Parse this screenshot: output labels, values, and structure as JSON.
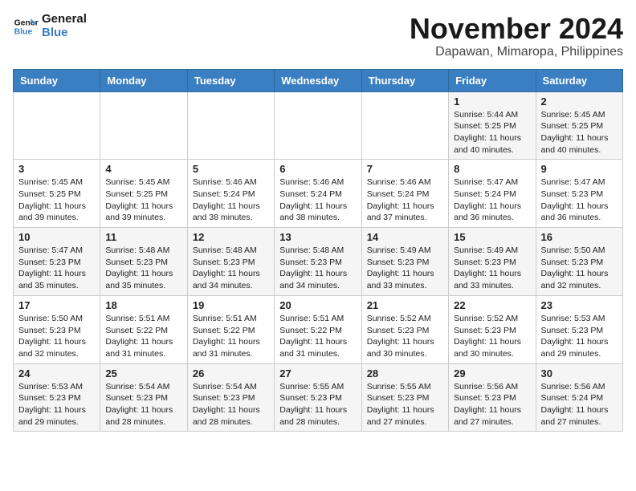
{
  "header": {
    "logo_line1": "General",
    "logo_line2": "Blue",
    "month_title": "November 2024",
    "location": "Dapawan, Mimaropa, Philippines"
  },
  "weekdays": [
    "Sunday",
    "Monday",
    "Tuesday",
    "Wednesday",
    "Thursday",
    "Friday",
    "Saturday"
  ],
  "weeks": [
    [
      {
        "day": "",
        "info": ""
      },
      {
        "day": "",
        "info": ""
      },
      {
        "day": "",
        "info": ""
      },
      {
        "day": "",
        "info": ""
      },
      {
        "day": "",
        "info": ""
      },
      {
        "day": "1",
        "info": "Sunrise: 5:44 AM\nSunset: 5:25 PM\nDaylight: 11 hours\nand 40 minutes."
      },
      {
        "day": "2",
        "info": "Sunrise: 5:45 AM\nSunset: 5:25 PM\nDaylight: 11 hours\nand 40 minutes."
      }
    ],
    [
      {
        "day": "3",
        "info": "Sunrise: 5:45 AM\nSunset: 5:25 PM\nDaylight: 11 hours\nand 39 minutes."
      },
      {
        "day": "4",
        "info": "Sunrise: 5:45 AM\nSunset: 5:25 PM\nDaylight: 11 hours\nand 39 minutes."
      },
      {
        "day": "5",
        "info": "Sunrise: 5:46 AM\nSunset: 5:24 PM\nDaylight: 11 hours\nand 38 minutes."
      },
      {
        "day": "6",
        "info": "Sunrise: 5:46 AM\nSunset: 5:24 PM\nDaylight: 11 hours\nand 38 minutes."
      },
      {
        "day": "7",
        "info": "Sunrise: 5:46 AM\nSunset: 5:24 PM\nDaylight: 11 hours\nand 37 minutes."
      },
      {
        "day": "8",
        "info": "Sunrise: 5:47 AM\nSunset: 5:24 PM\nDaylight: 11 hours\nand 36 minutes."
      },
      {
        "day": "9",
        "info": "Sunrise: 5:47 AM\nSunset: 5:23 PM\nDaylight: 11 hours\nand 36 minutes."
      }
    ],
    [
      {
        "day": "10",
        "info": "Sunrise: 5:47 AM\nSunset: 5:23 PM\nDaylight: 11 hours\nand 35 minutes."
      },
      {
        "day": "11",
        "info": "Sunrise: 5:48 AM\nSunset: 5:23 PM\nDaylight: 11 hours\nand 35 minutes."
      },
      {
        "day": "12",
        "info": "Sunrise: 5:48 AM\nSunset: 5:23 PM\nDaylight: 11 hours\nand 34 minutes."
      },
      {
        "day": "13",
        "info": "Sunrise: 5:48 AM\nSunset: 5:23 PM\nDaylight: 11 hours\nand 34 minutes."
      },
      {
        "day": "14",
        "info": "Sunrise: 5:49 AM\nSunset: 5:23 PM\nDaylight: 11 hours\nand 33 minutes."
      },
      {
        "day": "15",
        "info": "Sunrise: 5:49 AM\nSunset: 5:23 PM\nDaylight: 11 hours\nand 33 minutes."
      },
      {
        "day": "16",
        "info": "Sunrise: 5:50 AM\nSunset: 5:23 PM\nDaylight: 11 hours\nand 32 minutes."
      }
    ],
    [
      {
        "day": "17",
        "info": "Sunrise: 5:50 AM\nSunset: 5:23 PM\nDaylight: 11 hours\nand 32 minutes."
      },
      {
        "day": "18",
        "info": "Sunrise: 5:51 AM\nSunset: 5:22 PM\nDaylight: 11 hours\nand 31 minutes."
      },
      {
        "day": "19",
        "info": "Sunrise: 5:51 AM\nSunset: 5:22 PM\nDaylight: 11 hours\nand 31 minutes."
      },
      {
        "day": "20",
        "info": "Sunrise: 5:51 AM\nSunset: 5:22 PM\nDaylight: 11 hours\nand 31 minutes."
      },
      {
        "day": "21",
        "info": "Sunrise: 5:52 AM\nSunset: 5:23 PM\nDaylight: 11 hours\nand 30 minutes."
      },
      {
        "day": "22",
        "info": "Sunrise: 5:52 AM\nSunset: 5:23 PM\nDaylight: 11 hours\nand 30 minutes."
      },
      {
        "day": "23",
        "info": "Sunrise: 5:53 AM\nSunset: 5:23 PM\nDaylight: 11 hours\nand 29 minutes."
      }
    ],
    [
      {
        "day": "24",
        "info": "Sunrise: 5:53 AM\nSunset: 5:23 PM\nDaylight: 11 hours\nand 29 minutes."
      },
      {
        "day": "25",
        "info": "Sunrise: 5:54 AM\nSunset: 5:23 PM\nDaylight: 11 hours\nand 28 minutes."
      },
      {
        "day": "26",
        "info": "Sunrise: 5:54 AM\nSunset: 5:23 PM\nDaylight: 11 hours\nand 28 minutes."
      },
      {
        "day": "27",
        "info": "Sunrise: 5:55 AM\nSunset: 5:23 PM\nDaylight: 11 hours\nand 28 minutes."
      },
      {
        "day": "28",
        "info": "Sunrise: 5:55 AM\nSunset: 5:23 PM\nDaylight: 11 hours\nand 27 minutes."
      },
      {
        "day": "29",
        "info": "Sunrise: 5:56 AM\nSunset: 5:23 PM\nDaylight: 11 hours\nand 27 minutes."
      },
      {
        "day": "30",
        "info": "Sunrise: 5:56 AM\nSunset: 5:24 PM\nDaylight: 11 hours\nand 27 minutes."
      }
    ]
  ]
}
